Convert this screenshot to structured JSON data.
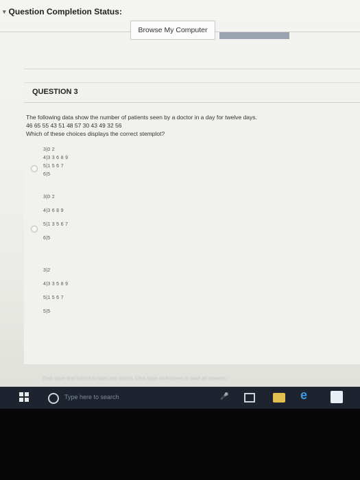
{
  "status": {
    "caret": "▾",
    "label": "Question Completion Status:"
  },
  "browse_button": "Browse My Computer",
  "question": {
    "title": "QUESTION 3",
    "line1": "The following data show the number of patients seen by a doctor in a day for twelve days.",
    "line2": "46 65 55 43 51 48 57 30 43 49 32 56",
    "line3": "Which of these choices displays the correct stemplot?"
  },
  "choices": [
    {
      "rows": [
        "3|0 2",
        "4|3 3 6 8 9",
        "5|1 5 6 7",
        "6|5"
      ]
    },
    {
      "rows": [
        "3|0 2",
        "4|3 6 8 9",
        "5|1 3 5 6 7",
        "6|5"
      ]
    },
    {
      "rows": [
        "3|2",
        "4|3 3 5 8 9",
        "5|1 5 6 7",
        "5|5"
      ]
    }
  ],
  "footer_hint": "Click Save and Submit to save and submit. Click Save All Answers to save all answers.",
  "taskbar": {
    "search_placeholder": "Type here to search",
    "icons": [
      "windows-icon",
      "cortana-icon",
      "mic-icon",
      "task-view-icon",
      "file-explorer-icon",
      "edge-icon",
      "store-icon"
    ]
  }
}
